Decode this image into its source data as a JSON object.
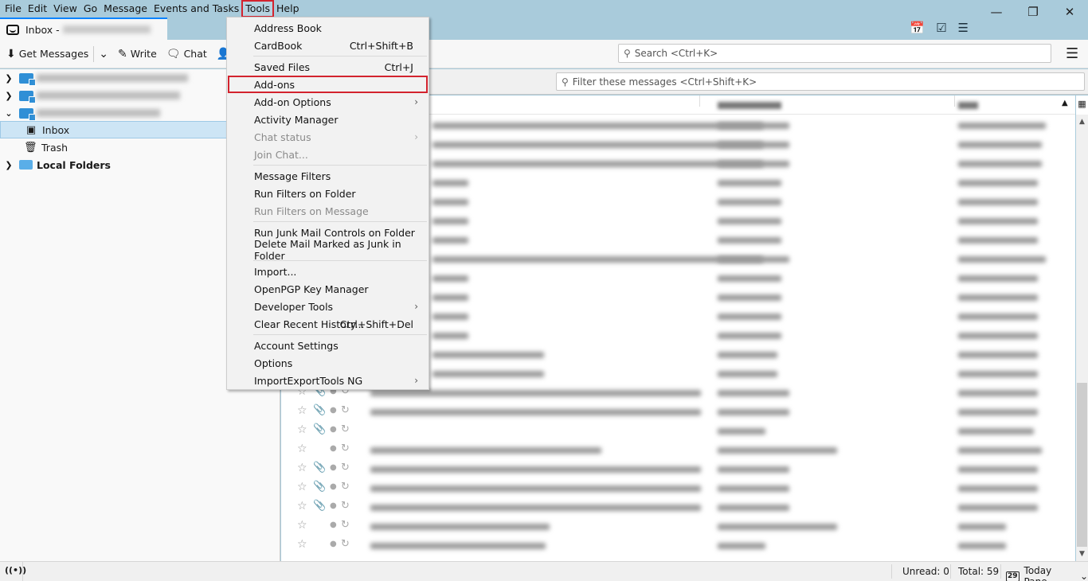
{
  "menubar": {
    "items": [
      "File",
      "Edit",
      "View",
      "Go",
      "Message",
      "Events and Tasks",
      "Tools",
      "Help"
    ],
    "active": "Tools"
  },
  "window_controls": {
    "minimize": "—",
    "restore": "❐",
    "close": "✕"
  },
  "tab": {
    "label": "Inbox - ",
    "suffix": "s.c"
  },
  "spaces_toolbar": {
    "calendar_icon": "calendar-icon",
    "tasks_icon": "tasks-icon",
    "address_icon": "address-book-icon"
  },
  "toolbar": {
    "get_messages": "Get Messages",
    "write": "Write",
    "chat": "Chat",
    "address": "A",
    "search_placeholder": "Search <Ctrl+K>"
  },
  "folders": {
    "accounts": [
      {
        "expanded": false
      },
      {
        "expanded": false
      },
      {
        "expanded": true
      }
    ],
    "inbox": "Inbox",
    "trash": "Trash",
    "local_folders": "Local Folders"
  },
  "filter": {
    "placeholder": "Filter these messages <Ctrl+Shift+K>"
  },
  "thread_rows": [
    {
      "attach": false
    },
    {
      "attach": false
    },
    {
      "attach": false
    },
    {
      "attach": false
    },
    {
      "attach": false
    },
    {
      "attach": false
    },
    {
      "attach": false
    },
    {
      "attach": false
    },
    {
      "attach": false
    },
    {
      "attach": false
    },
    {
      "attach": false
    },
    {
      "attach": false
    },
    {
      "attach": false
    },
    {
      "attach": false
    },
    {
      "attach": true
    },
    {
      "attach": true
    },
    {
      "attach": true
    },
    {
      "attach": false
    },
    {
      "attach": true
    },
    {
      "attach": true
    },
    {
      "attach": true
    },
    {
      "attach": false
    },
    {
      "attach": false
    }
  ],
  "tools_menu": {
    "groups": [
      [
        {
          "label": "Address Book",
          "shortcut": "",
          "submenu": false,
          "disabled": false
        },
        {
          "label": "CardBook",
          "shortcut": "Ctrl+Shift+B",
          "submenu": false,
          "disabled": false
        }
      ],
      [
        {
          "label": "Saved Files",
          "shortcut": "Ctrl+J",
          "submenu": false,
          "disabled": false
        },
        {
          "label": "Add-ons",
          "shortcut": "",
          "submenu": false,
          "disabled": false,
          "highlighted": true
        },
        {
          "label": "Add-on Options",
          "shortcut": "",
          "submenu": true,
          "disabled": false
        },
        {
          "label": "Activity Manager",
          "shortcut": "",
          "submenu": false,
          "disabled": false
        },
        {
          "label": "Chat status",
          "shortcut": "",
          "submenu": true,
          "disabled": true
        },
        {
          "label": "Join Chat...",
          "shortcut": "",
          "submenu": false,
          "disabled": true
        }
      ],
      [
        {
          "label": "Message Filters",
          "shortcut": "",
          "submenu": false,
          "disabled": false
        },
        {
          "label": "Run Filters on Folder",
          "shortcut": "",
          "submenu": false,
          "disabled": false
        },
        {
          "label": "Run Filters on Message",
          "shortcut": "",
          "submenu": false,
          "disabled": true
        }
      ],
      [
        {
          "label": "Run Junk Mail Controls on Folder",
          "shortcut": "",
          "submenu": false,
          "disabled": false
        },
        {
          "label": "Delete Mail Marked as Junk in Folder",
          "shortcut": "",
          "submenu": false,
          "disabled": false
        }
      ],
      [
        {
          "label": "Import...",
          "shortcut": "",
          "submenu": false,
          "disabled": false
        },
        {
          "label": "OpenPGP Key Manager",
          "shortcut": "",
          "submenu": false,
          "disabled": false
        },
        {
          "label": "Developer Tools",
          "shortcut": "",
          "submenu": true,
          "disabled": false
        },
        {
          "label": "Clear Recent History...",
          "shortcut": "Ctrl+Shift+Del",
          "submenu": false,
          "disabled": false
        }
      ],
      [
        {
          "label": "Account Settings",
          "shortcut": "",
          "submenu": false,
          "disabled": false
        },
        {
          "label": "Options",
          "shortcut": "",
          "submenu": false,
          "disabled": false
        },
        {
          "label": "ImportExportTools NG",
          "shortcut": "",
          "submenu": true,
          "disabled": false
        }
      ]
    ]
  },
  "statusbar": {
    "unread": "Unread: 0",
    "total": "Total: 59",
    "today_pane": "Today Pane",
    "today_day": "29"
  },
  "colors": {
    "titlebar": "#a9cbdb",
    "highlight_box": "#d3232e",
    "selected_folder": "#cde5f5",
    "account_icon": "#2f8fd6"
  }
}
